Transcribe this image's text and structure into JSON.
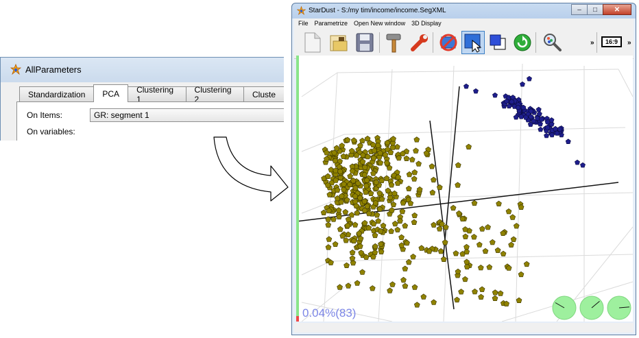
{
  "all_parameters": {
    "title": "AllParameters",
    "tabs": [
      {
        "label": "Standardization",
        "active": false
      },
      {
        "label": "PCA",
        "active": true
      },
      {
        "label": "Clustering 1",
        "active": false
      },
      {
        "label": "Clustering 2",
        "active": false
      },
      {
        "label": "Cluste",
        "active": false
      }
    ],
    "on_items_label": "On Items:",
    "on_items_value": "GR: segment 1",
    "on_variables_label": "On variables:"
  },
  "stardust": {
    "title": "StarDust - S:/my tim/income/income.SegXML",
    "menu": [
      "File",
      "Parametrize",
      "Open New window",
      "3D Display"
    ],
    "toolbar": {
      "overflow_label_1": "»",
      "overflow_label_2": "»",
      "aspect_label": "16:9"
    },
    "status_text": "0.04%(83)",
    "colors": {
      "yellow_cluster": "#8f8200",
      "blue_cluster": "#1e1e8c",
      "progress": "#8ae58a",
      "percent_text": "#7c86e6",
      "orientation_discs": "#9ef09e"
    }
  }
}
